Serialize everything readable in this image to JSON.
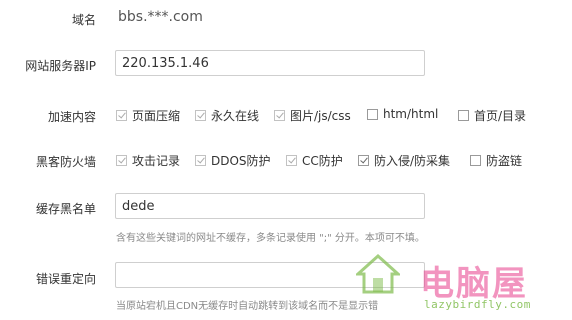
{
  "domain": {
    "label": "域名",
    "value": "bbs.***.com"
  },
  "server_ip": {
    "label": "网站服务器IP",
    "value": "220.135.1.46"
  },
  "acceleration": {
    "label": "加速内容",
    "options": [
      {
        "label": "页面压缩",
        "checked": true,
        "dim": true
      },
      {
        "label": "永久在线",
        "checked": true,
        "dim": true
      },
      {
        "label": "图片/js/css",
        "checked": true,
        "dim": true
      },
      {
        "label": "htm/html",
        "checked": false,
        "dim": false
      },
      {
        "label": "首页/目录",
        "checked": false,
        "dim": false
      }
    ]
  },
  "firewall": {
    "label": "黑客防火墙",
    "options": [
      {
        "label": "攻击记录",
        "checked": true,
        "dim": true
      },
      {
        "label": "DDOS防护",
        "checked": true,
        "dim": true
      },
      {
        "label": "CC防护",
        "checked": true,
        "dim": true
      },
      {
        "label": "防入侵/防采集",
        "checked": true,
        "dim": false
      },
      {
        "label": "防盗链",
        "checked": false,
        "dim": false
      }
    ]
  },
  "cache_blacklist": {
    "label": "缓存黑名单",
    "value": "dede",
    "hint": "含有这些关键词的网址不缓存，多条记录使用 \";\" 分开。本项可不填。"
  },
  "error_redirect": {
    "label": "错误重定向",
    "value": "",
    "hint": "当原站宕机且CDN无缓存时自动跳转到该域名而不是显示错"
  },
  "watermark": {
    "title": "电脑屋",
    "url": "lazybirdfly.com"
  },
  "colors": {
    "label": "#333333",
    "hint": "#8a8a8a",
    "border": "#cfcfcf",
    "watermark_pink": "#e83e8c",
    "watermark_green": "#7dbb4a"
  }
}
